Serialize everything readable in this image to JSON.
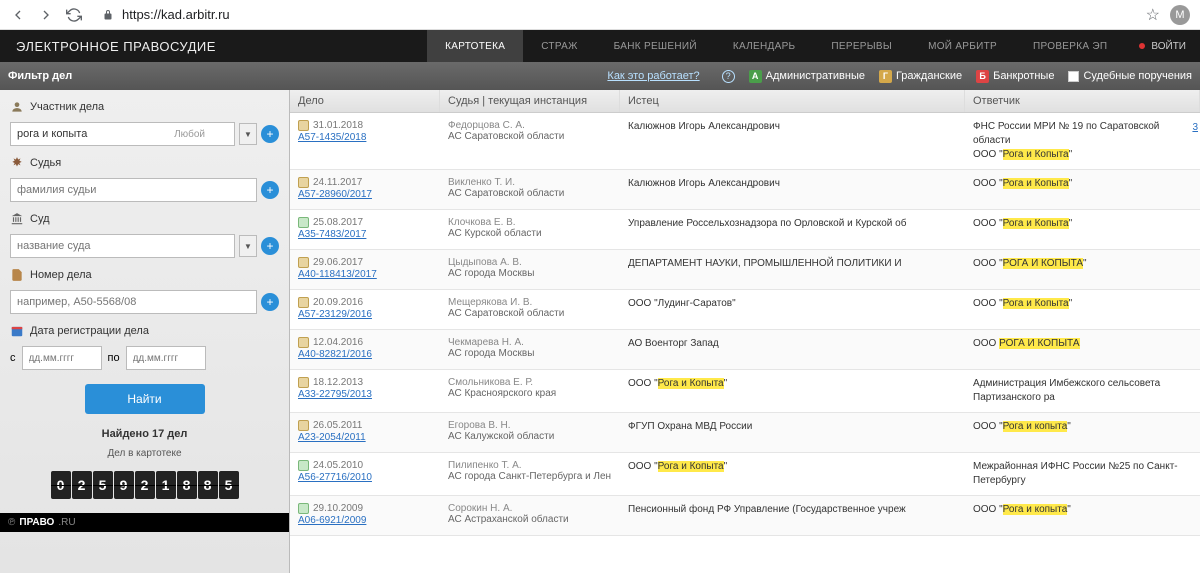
{
  "browser": {
    "url": "https://kad.arbitr.ru",
    "avatar": "M"
  },
  "brand": "ЭЛЕКТРОННОЕ ПРАВОСУДИЕ",
  "tabs": [
    "КАРТОТЕКА",
    "СТРАЖ",
    "БАНК РЕШЕНИЙ",
    "КАЛЕНДАРЬ",
    "ПЕРЕРЫВЫ",
    "МОЙ АРБИТР",
    "ПРОВЕРКА ЭП"
  ],
  "active_tab": 0,
  "login": "ВОЙТИ",
  "filter": {
    "title": "Фильтр дел",
    "how": "Как это работает?",
    "types": [
      "Административные",
      "Гражданские",
      "Банкротные",
      "Судебные поручения"
    ]
  },
  "sidebar": {
    "participant_label": "Участник дела",
    "participant_value": "рога и копыта",
    "any": "Любой",
    "judge_label": "Судья",
    "judge_placeholder": "фамилия судьи",
    "court_label": "Суд",
    "court_placeholder": "название суда",
    "case_label": "Номер дела",
    "case_placeholder": "например, А50-5568/08",
    "date_label": "Дата регистрации дела",
    "date_from": "с",
    "date_to": "по",
    "date_ph": "дд.мм.гггг",
    "search": "Найти",
    "found": "Найдено 17 дел",
    "found_sub": "Дел в картотеке",
    "counter": [
      "0",
      "2",
      "5",
      "9",
      "2",
      "1",
      "8",
      "8",
      "5"
    ],
    "pravo": "ПРАВО",
    "pravo_suffix": ".RU"
  },
  "cols": [
    "Дело",
    "Судья | текущая инстанция",
    "Истец",
    "Ответчик"
  ],
  "scroll_num": "3",
  "rows": [
    {
      "icon": "g",
      "date": "31.01.2018",
      "num": "А57-1435/2018",
      "judge": "Федорцова С. А.",
      "court": "АС Саратовской области",
      "plt": "Калюжнов Игорь Александрович",
      "def_prefix": "ФНС России МРИ № 19 по Саратовской области\nООО \"",
      "def_hlt": "Рога и Копыта",
      "def_suffix": "\""
    },
    {
      "icon": "g",
      "date": "24.11.2017",
      "num": "А57-28960/2017",
      "judge": "Викленко Т. И.",
      "court": "АС Саратовской области",
      "plt": "Калюжнов Игорь Александрович",
      "def_prefix": "ООО \"",
      "def_hlt": "Рога и Копыта",
      "def_suffix": "\""
    },
    {
      "icon": "a",
      "date": "25.08.2017",
      "num": "А35-7483/2017",
      "judge": "Клочкова Е. В.",
      "court": "АС Курской области",
      "plt": "Управление Россельхознадзора по Орловской и Курской об",
      "def_prefix": "ООО \"",
      "def_hlt": "Рога и Копыта",
      "def_suffix": "\""
    },
    {
      "icon": "y",
      "date": "29.06.2017",
      "num": "А40-118413/2017",
      "judge": "Цыдыпова А. В.",
      "court": "АС города Москвы",
      "plt": "ДЕПАРТАМЕНТ НАУКИ, ПРОМЫШЛЕННОЙ ПОЛИТИКИ И",
      "def_prefix": "ООО \"",
      "def_hlt": "РОГА И КОПЫТА",
      "def_suffix": "\""
    },
    {
      "icon": "g",
      "date": "20.09.2016",
      "num": "А57-23129/2016",
      "judge": "Мещерякова И. В.",
      "court": "АС Саратовской области",
      "plt": "ООО \"Лудинг-Саратов\"",
      "def_prefix": "ООО \"",
      "def_hlt": "Рога и Копыта",
      "def_suffix": "\""
    },
    {
      "icon": "g",
      "date": "12.04.2016",
      "num": "А40-82821/2016",
      "judge": "Чекмарева Н. А.",
      "court": "АС города Москвы",
      "plt": "АО Военторг Запад",
      "def_prefix": "ООО ",
      "def_hlt": "РОГА И КОПЫТА",
      "def_suffix": ""
    },
    {
      "icon": "g",
      "date": "18.12.2013",
      "num": "А33-22795/2013",
      "judge": "Смольникова Е. Р.",
      "court": "АС Красноярского края",
      "plt_prefix": "ООО \"",
      "plt_hlt": "Рога и Копыта",
      "plt_suffix": "\"",
      "def": "Администрация Имбежского сельсовета Партизанского ра"
    },
    {
      "icon": "g",
      "date": "26.05.2011",
      "num": "А23-2054/2011",
      "judge": "Егорова В. Н.",
      "court": "АС Калужской области",
      "plt": "ФГУП Охрана МВД России",
      "def_prefix": "ООО \"",
      "def_hlt": "Рога и копыта",
      "def_suffix": "\""
    },
    {
      "icon": "a",
      "date": "24.05.2010",
      "num": "А56-27716/2010",
      "judge": "Пилипенко Т. А.",
      "court": "АС города Санкт-Петербурга и Лен",
      "plt_prefix": "ООО \"",
      "plt_hlt": "Рога и Копыта",
      "plt_suffix": "\"",
      "def": "Межрайонная ИФНС России №25 по Санкт-Петербургу"
    },
    {
      "icon": "a",
      "date": "29.10.2009",
      "num": "А06-6921/2009",
      "judge": "Сорокин Н. А.",
      "court": "АС Астраханской области",
      "plt": "Пенсионный фонд РФ Управление (Государственное учреж",
      "def_prefix": "ООО \"",
      "def_hlt": "Рога и копыта",
      "def_suffix": "\""
    }
  ]
}
